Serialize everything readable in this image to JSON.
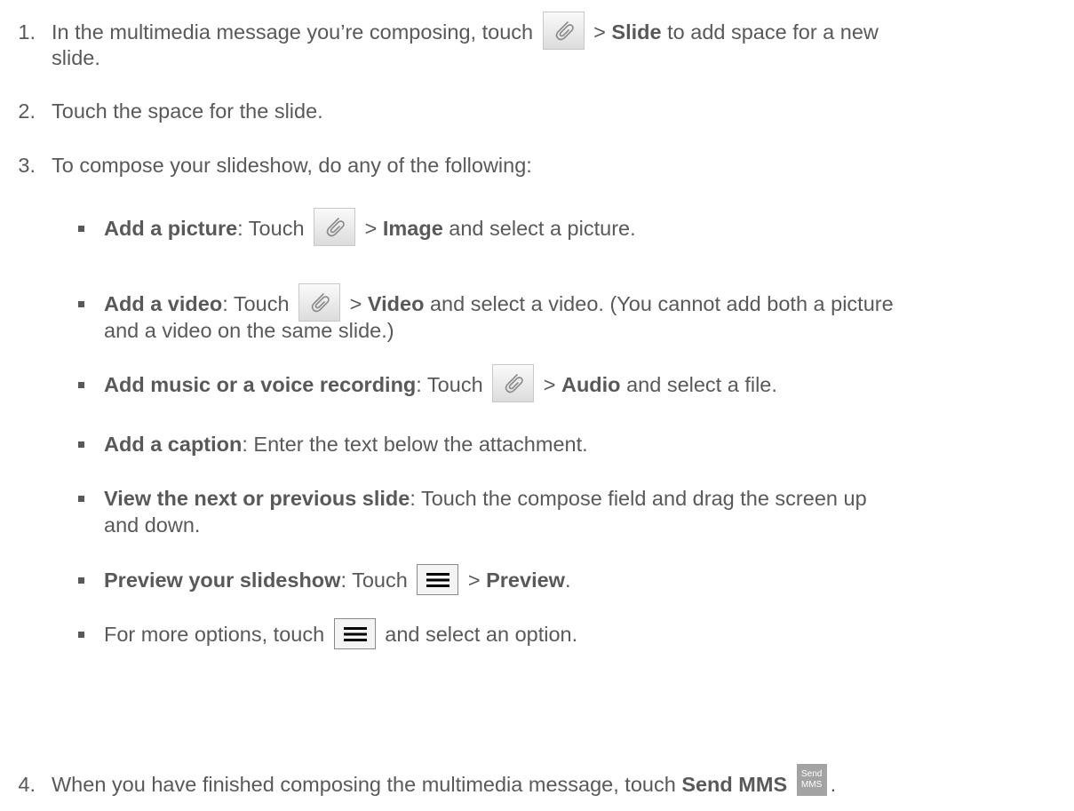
{
  "steps": [
    {
      "number": "1.",
      "pre": "In the multimedia message you’re composing, touch",
      "icon": "paperclip-icon",
      "sep": ">",
      "bold": "Slide",
      "post": "to add space for a new",
      "cont": "slide."
    },
    {
      "number": "2.",
      "text": "Touch the space for the slide."
    },
    {
      "number": "3.",
      "text": "To compose your slideshow, do any of the following:"
    },
    {
      "number": "4.",
      "pre": "When you have finished composing the multimedia message, touch",
      "bold": "Send MMS",
      "icon": "send-mms-icon",
      "icon_text": [
        "Send",
        "MMS"
      ],
      "post": "."
    }
  ],
  "bullets": [
    {
      "bold": "Add a picture",
      "pre": ": Touch",
      "icon": "paperclip-icon",
      "sep": ">",
      "bold2": "Image",
      "post": "and select a picture."
    },
    {
      "bold": "Add a video",
      "pre": ": Touch",
      "icon": "paperclip-icon",
      "sep": ">",
      "bold2": "Video",
      "post": "and select a video. (You cannot add both a picture",
      "cont": "and a video on the same slide.)"
    },
    {
      "bold": "Add music or a voice recording",
      "pre": ": Touch",
      "icon": "paperclip-icon",
      "sep": ">",
      "bold2": "Audio",
      "post": "and select a file."
    },
    {
      "bold": "Add a caption",
      "post": ": Enter the text below the attachment."
    },
    {
      "bold": "View the next or previous slide",
      "post": ": Touch the compose field and drag the screen up",
      "cont": "and down."
    },
    {
      "bold": "Preview your slideshow",
      "pre": ": Touch",
      "icon": "menu-icon",
      "sep": ">",
      "bold2": "Preview",
      "post": "."
    },
    {
      "pre": "For more options, touch",
      "icon": "menu-icon",
      "post": "and select an option."
    }
  ]
}
